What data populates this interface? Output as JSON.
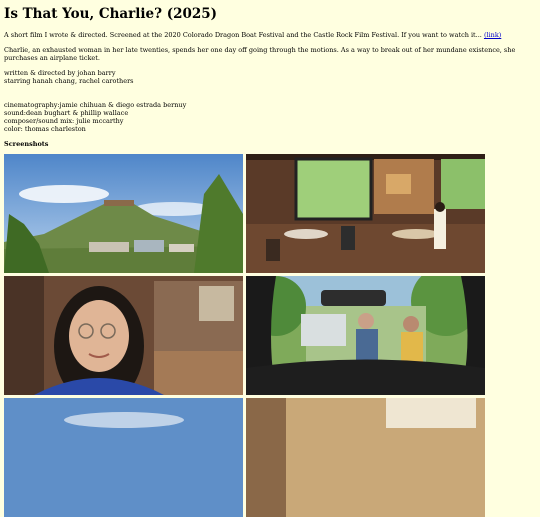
{
  "title": "Is That You, Charlie? (2025)",
  "intro": {
    "text": "A short film I wrote & directed. Screened at the 2020 Colorado Dragon Boat Festival and the Castle Rock Film Festival. If you want to watch it...",
    "link_label": "(link)"
  },
  "synopsis": "Charlie, an exhausted woman in her late twenties, spends her one day off going through the motions. As a way to break out of her mundane existence, she purchases an airplane ticket.",
  "credits_a": [
    "written & directed by johan barry",
    "starring hanah chang, rachel carothers"
  ],
  "credits_b": [
    "cinematography:jamie chihuan & diego estrada bernuy",
    "sound:dean bughart & phillip wallace",
    "composer/sound mix: julie mccarthy",
    "color: thomas charleston"
  ],
  "screenshots_heading": "Screenshots",
  "screenshots": [
    {
      "name": "screenshot-mountain-town",
      "alt_icon": "landscape-photo"
    },
    {
      "name": "screenshot-cafe-interior",
      "alt_icon": "interior-photo"
    },
    {
      "name": "screenshot-woman-glasses",
      "alt_icon": "portrait-photo"
    },
    {
      "name": "screenshot-car-windshield",
      "alt_icon": "street-photo"
    },
    {
      "name": "screenshot-sky-partial",
      "alt_icon": "sky-photo"
    },
    {
      "name": "screenshot-room-partial",
      "alt_icon": "room-photo"
    }
  ],
  "colors": {
    "background": "#ffffe0",
    "link": "#0000cc"
  }
}
